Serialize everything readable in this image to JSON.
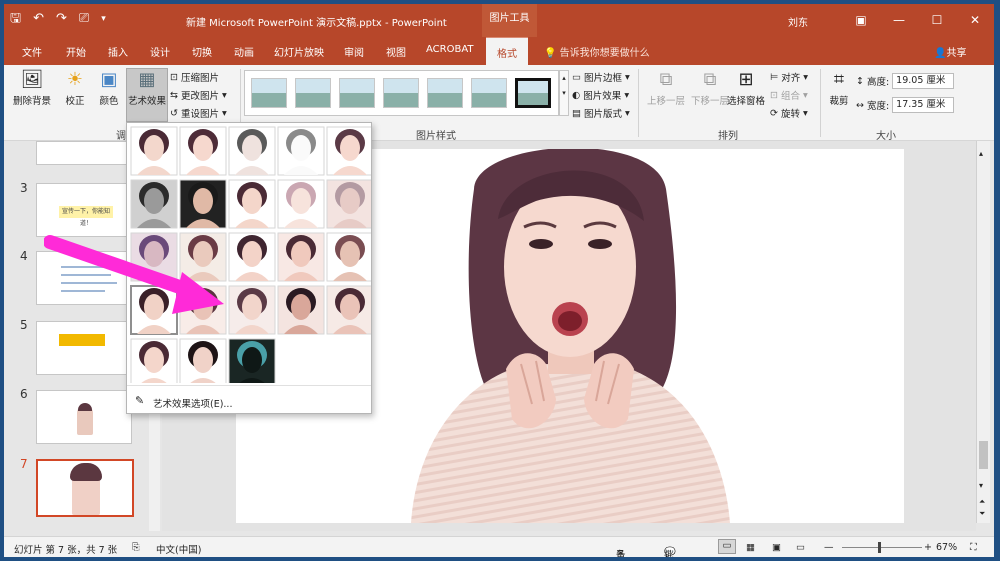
{
  "title_bar": {
    "save_icon": "save-icon",
    "doc_title": "新建 Microsoft PowerPoint 演示文稿.pptx - PowerPoint",
    "context_tool": "图片工具",
    "user": "刘东",
    "accent": "#b7472a"
  },
  "tabs": [
    "文件",
    "开始",
    "插入",
    "设计",
    "切换",
    "动画",
    "幻灯片放映",
    "审阅",
    "视图",
    "ACROBAT"
  ],
  "active_tab": "格式",
  "tell_me": "告诉我你想要做什么",
  "share": "共享",
  "ribbon": {
    "remove_bg": "删除背景",
    "corrections": "校正",
    "color": "颜色",
    "artistic": "艺术效果",
    "compress": "压缩图片",
    "change": "更改图片",
    "reset": "重设图片",
    "adjust_group": "调",
    "styles_group": "图片样式",
    "border": "图片边框",
    "effects": "图片效果",
    "layout": "图片版式",
    "bring_forward": "上移一层",
    "send_backward": "下移一层",
    "selection_pane": "选择窗格",
    "align": "对齐",
    "group": "组合",
    "rotate": "旋转",
    "arrange_group": "排列",
    "crop": "裁剪",
    "height_label": "高度:",
    "height_value": "19.05 厘米",
    "width_label": "宽度:",
    "width_value": "17.35 厘米",
    "size_group": "大小"
  },
  "thumbnails": [
    {
      "num": "3",
      "text": "宣传一下，你能知道！"
    },
    {
      "num": "4",
      "text": ""
    },
    {
      "num": "5",
      "text": ""
    },
    {
      "num": "6",
      "text": ""
    },
    {
      "num": "7",
      "text": ""
    }
  ],
  "gallery": {
    "footer": "艺术效果选项(E)...",
    "selected_index": 15
  },
  "status": {
    "slide_info": "幻灯片 第 7 张，共 7 张",
    "language": "中文(中国)",
    "notes": "备注",
    "comments": "批注",
    "zoom": "67%"
  }
}
